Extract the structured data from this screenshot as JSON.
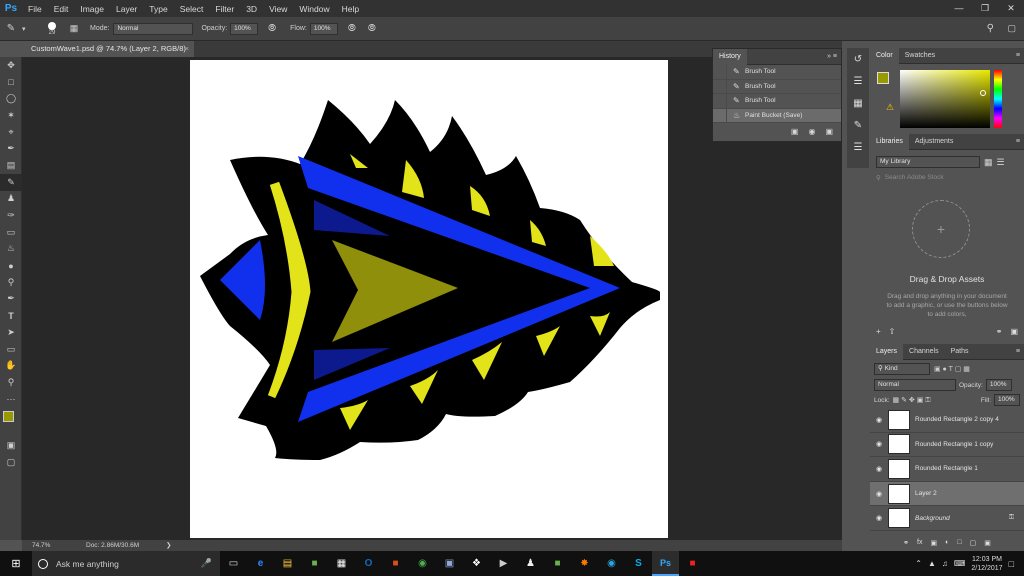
{
  "app": {
    "logo": "Ps"
  },
  "menu": [
    "File",
    "Edit",
    "Image",
    "Layer",
    "Type",
    "Select",
    "Filter",
    "3D",
    "View",
    "Window",
    "Help"
  ],
  "options": {
    "brush_size": "29",
    "mode_label": "Mode:",
    "mode_value": "Normal",
    "opacity_label": "Opacity:",
    "opacity_value": "100%",
    "flow_label": "Flow:",
    "flow_value": "100%"
  },
  "document": {
    "tab_title": "CustomWave1.psd @ 74.7% (Layer 2, RGB/8)",
    "zoom": "74.7%",
    "doc_size": "Doc: 2.86M/30.6M"
  },
  "history": {
    "title": "History",
    "items": [
      {
        "label": "Brush Tool",
        "selected": false
      },
      {
        "label": "Brush Tool",
        "selected": false
      },
      {
        "label": "Brush Tool",
        "selected": false
      },
      {
        "label": "Paint Bucket (Save)",
        "selected": true
      }
    ]
  },
  "color_panel": {
    "tabs": [
      "Color",
      "Swatches"
    ],
    "foreground": "#999900"
  },
  "libraries": {
    "tabs": [
      "Libraries",
      "Adjustments"
    ],
    "library_name": "My Library",
    "search_placeholder": "Search Adobe Stock",
    "drop_title": "Drag & Drop Assets",
    "drop_text": "Drag and drop anything in your document to add a graphic, or use the buttons below to add colors,"
  },
  "layers": {
    "tabs": [
      "Layers",
      "Channels",
      "Paths"
    ],
    "filter": "Kind",
    "blend_mode": "Normal",
    "opacity_label": "Opacity:",
    "opacity_value": "100%",
    "lock_label": "Lock:",
    "fill_label": "Fill:",
    "fill_value": "100%",
    "items": [
      {
        "name": "Rounded Rectangle 2 copy 4",
        "selected": false
      },
      {
        "name": "Rounded Rectangle 1 copy",
        "selected": false
      },
      {
        "name": "Rounded Rectangle 1",
        "selected": false
      },
      {
        "name": "Layer 2",
        "selected": true
      },
      {
        "name": "Background",
        "selected": false
      }
    ]
  },
  "taskbar": {
    "search_placeholder": "Ask me anything",
    "time": "12:03 PM",
    "date": "2/12/2017"
  },
  "colors": {
    "blue": "#1130ee",
    "yellow": "#e3e31a",
    "olive": "#8f8f0c",
    "darkblue": "#0d1a8e"
  }
}
